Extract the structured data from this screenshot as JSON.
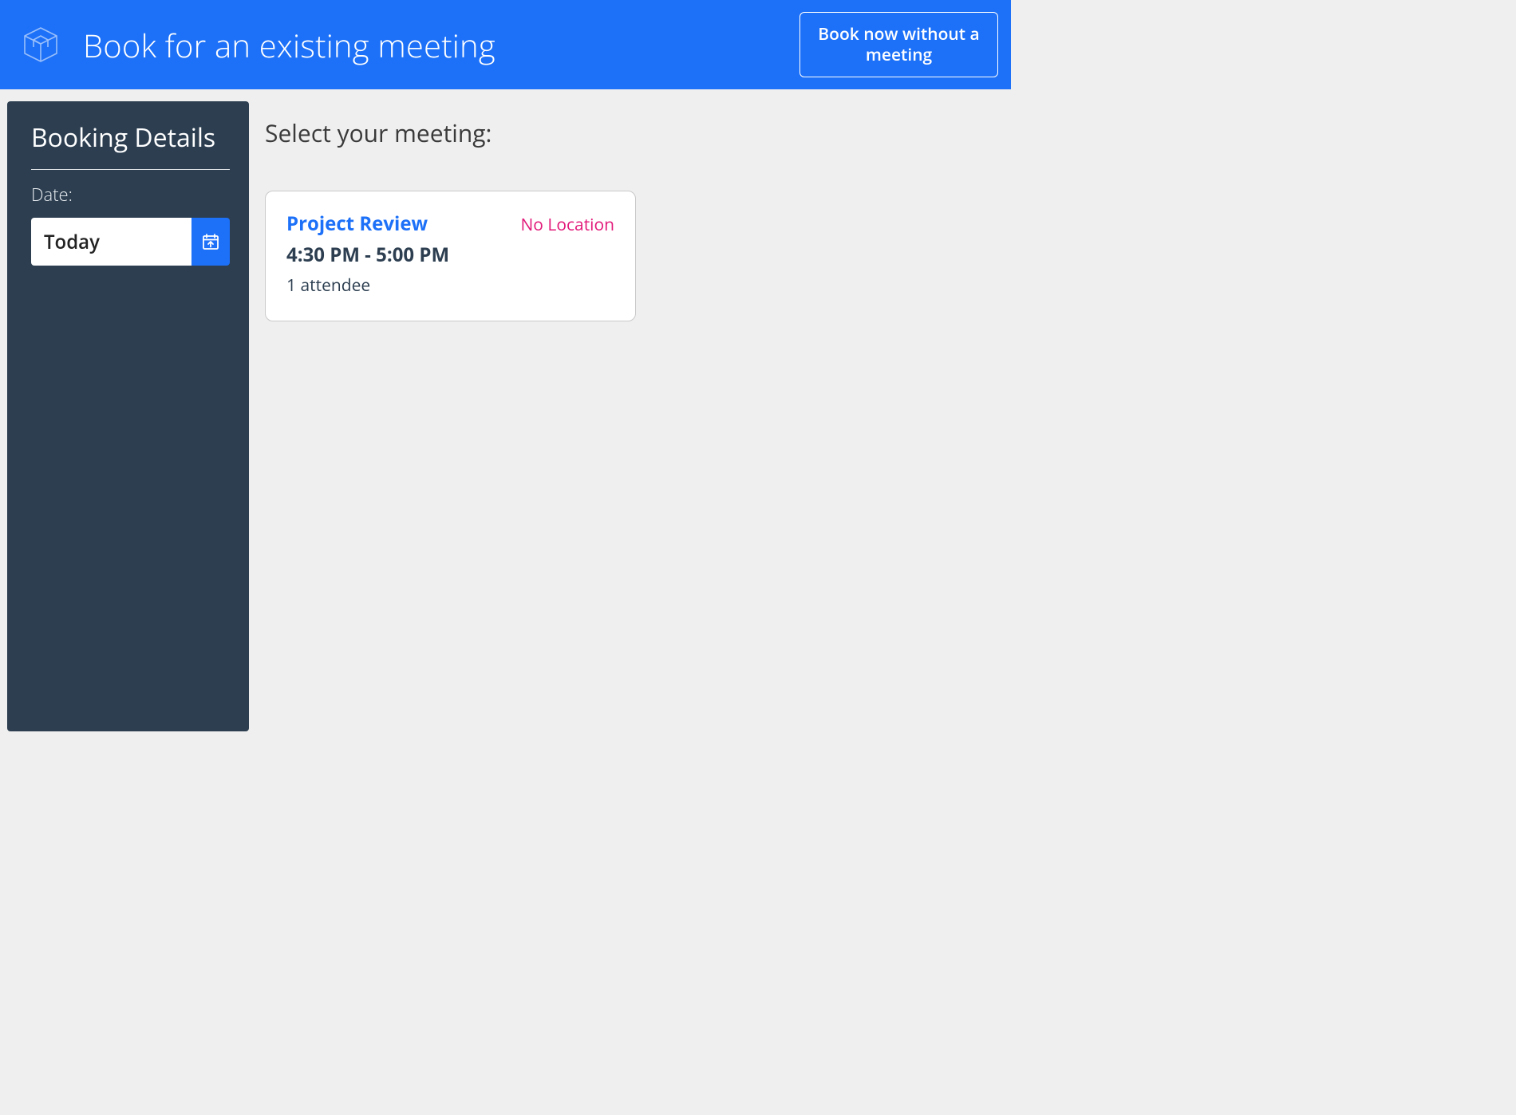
{
  "header": {
    "title": "Book for an existing meeting",
    "cta": "Book now without a meeting"
  },
  "sidebar": {
    "title": "Booking Details",
    "date_label": "Date:",
    "date_value": "Today"
  },
  "main": {
    "title": "Select your meeting:"
  },
  "meetings": [
    {
      "title": "Project Review",
      "location": "No Location",
      "time": "4:30 PM - 5:00 PM",
      "attendees": "1 attendee"
    }
  ],
  "colors": {
    "primary": "#1d71f8",
    "sidebar": "#2c3e50",
    "bg": "#efefef",
    "accent_pink": "#e21a7a"
  }
}
